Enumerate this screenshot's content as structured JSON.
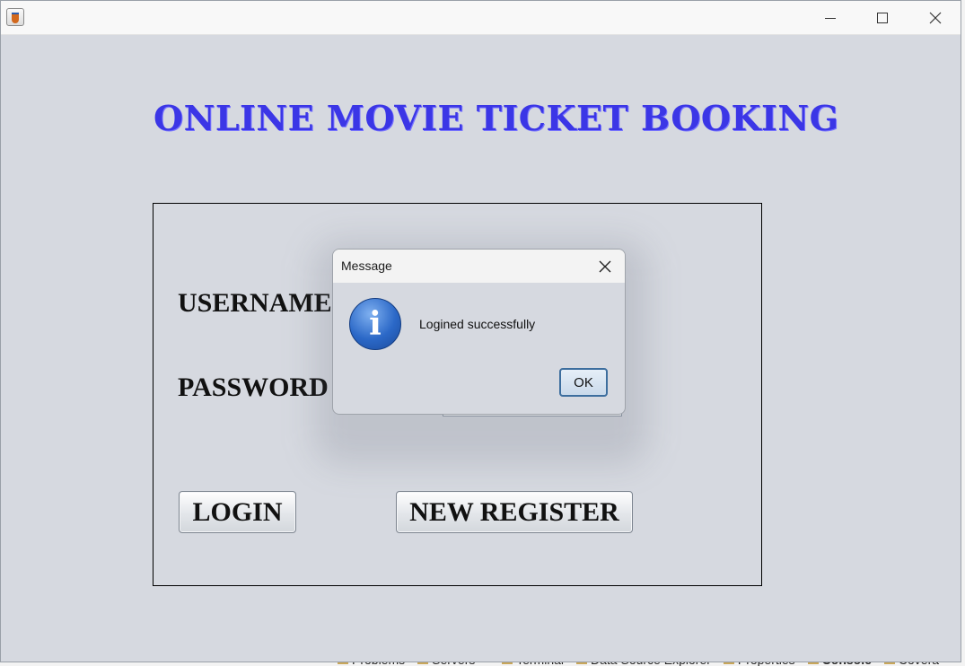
{
  "background_ide": {
    "bottom_tabs": [
      {
        "label": "Problems",
        "bold": false
      },
      {
        "label": "Servers",
        "bold": false
      },
      {
        "label": "Terminal",
        "bold": false
      },
      {
        "label": "Data Source Explorer",
        "bold": false
      },
      {
        "label": "Properties",
        "bold": false
      },
      {
        "label": "Console",
        "bold": true
      },
      {
        "label": "Covera",
        "bold": false
      }
    ]
  },
  "window": {
    "title": "",
    "icon": "java-app-icon",
    "controls": [
      "minimize-icon",
      "maximize-icon",
      "close-icon"
    ]
  },
  "app": {
    "heading": "ONLINE MOVIE TICKET BOOKING",
    "username_label": "USERNAME",
    "password_label": "PASSWORD",
    "login_button": "LOGIN",
    "register_button": "NEW REGISTER"
  },
  "dialog": {
    "title": "Message",
    "icon": "info-icon",
    "message": "Logined successfully",
    "ok_label": "OK"
  },
  "colors": {
    "heading": "#3b36e6",
    "window_bg": "#d6d9e0",
    "ok_border": "#3d6e9e"
  }
}
